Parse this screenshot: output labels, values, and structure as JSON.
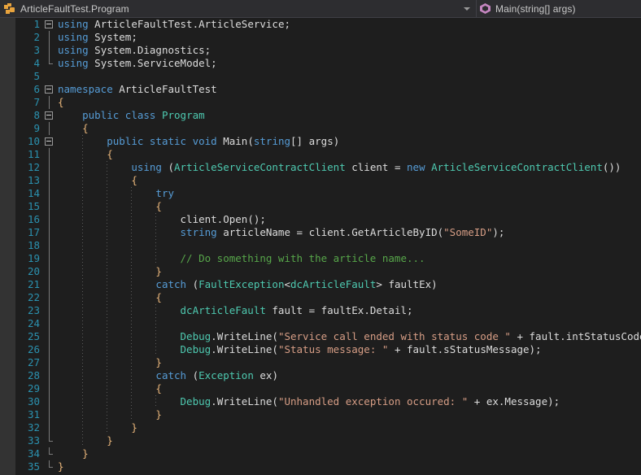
{
  "navbar": {
    "class_dropdown": {
      "icon": "class-icon",
      "label": "ArticleFaultTest.Program"
    },
    "method_dropdown": {
      "icon": "method-icon",
      "label": "Main(string[] args)"
    },
    "dropdown_arrow_icon": "chevron-down-icon"
  },
  "colors": {
    "background": "#1e1e1e",
    "navbar_background": "#2d2d30",
    "indicator_margin": "#333333",
    "line_number": "#2b91af",
    "keyword": "#569cd6",
    "type": "#4ec9b0",
    "string": "#d69d85",
    "comment": "#57a64a",
    "plain_text": "#dcdcdc",
    "brace": "#e8b57a",
    "class_icon": "#e8a33d",
    "method_icon": "#c586c0"
  },
  "editor": {
    "language": "csharp",
    "first_line": 1,
    "last_line": 35,
    "lines": [
      {
        "n": 1,
        "fold": "box",
        "indent": 0,
        "tokens": [
          {
            "t": "k",
            "v": "using"
          },
          {
            "t": "p",
            "v": " "
          },
          {
            "t": "p",
            "v": "ArticleFaultTest"
          },
          {
            "t": "op",
            "v": "."
          },
          {
            "t": "p",
            "v": "ArticleService"
          },
          {
            "t": "op",
            "v": ";"
          }
        ]
      },
      {
        "n": 2,
        "fold": "line",
        "indent": 0,
        "tokens": [
          {
            "t": "k",
            "v": "using"
          },
          {
            "t": "p",
            "v": " System"
          },
          {
            "t": "op",
            "v": ";"
          }
        ]
      },
      {
        "n": 3,
        "fold": "line",
        "indent": 0,
        "tokens": [
          {
            "t": "k",
            "v": "using"
          },
          {
            "t": "p",
            "v": " System"
          },
          {
            "t": "op",
            "v": "."
          },
          {
            "t": "p",
            "v": "Diagnostics"
          },
          {
            "t": "op",
            "v": ";"
          }
        ]
      },
      {
        "n": 4,
        "fold": "endcap",
        "indent": 0,
        "tokens": [
          {
            "t": "k",
            "v": "using"
          },
          {
            "t": "p",
            "v": " System"
          },
          {
            "t": "op",
            "v": "."
          },
          {
            "t": "p",
            "v": "ServiceModel"
          },
          {
            "t": "op",
            "v": ";"
          }
        ]
      },
      {
        "n": 5,
        "fold": "none",
        "indent": 0,
        "tokens": []
      },
      {
        "n": 6,
        "fold": "box",
        "indent": 0,
        "tokens": [
          {
            "t": "k",
            "v": "namespace"
          },
          {
            "t": "p",
            "v": " ArticleFaultTest"
          }
        ]
      },
      {
        "n": 7,
        "fold": "line",
        "indent": 0,
        "tokens": [
          {
            "t": "b",
            "v": "{"
          }
        ]
      },
      {
        "n": 8,
        "fold": "box",
        "indent": 1,
        "tokens": [
          {
            "t": "k",
            "v": "public"
          },
          {
            "t": "p",
            "v": " "
          },
          {
            "t": "k",
            "v": "class"
          },
          {
            "t": "p",
            "v": " "
          },
          {
            "t": "t",
            "v": "Program"
          }
        ]
      },
      {
        "n": 9,
        "fold": "line",
        "indent": 1,
        "tokens": [
          {
            "t": "b",
            "v": "{"
          }
        ]
      },
      {
        "n": 10,
        "fold": "box",
        "indent": 2,
        "tokens": [
          {
            "t": "k",
            "v": "public"
          },
          {
            "t": "p",
            "v": " "
          },
          {
            "t": "k",
            "v": "static"
          },
          {
            "t": "p",
            "v": " "
          },
          {
            "t": "k",
            "v": "void"
          },
          {
            "t": "p",
            "v": " Main"
          },
          {
            "t": "op",
            "v": "("
          },
          {
            "t": "k",
            "v": "string"
          },
          {
            "t": "op",
            "v": "[]"
          },
          {
            "t": "p",
            "v": " args"
          },
          {
            "t": "op",
            "v": ")"
          }
        ]
      },
      {
        "n": 11,
        "fold": "line",
        "indent": 2,
        "tokens": [
          {
            "t": "b",
            "v": "{"
          }
        ]
      },
      {
        "n": 12,
        "fold": "line",
        "indent": 3,
        "tokens": [
          {
            "t": "k",
            "v": "using"
          },
          {
            "t": "p",
            "v": " "
          },
          {
            "t": "op",
            "v": "("
          },
          {
            "t": "t",
            "v": "ArticleServiceContractClient"
          },
          {
            "t": "p",
            "v": " client "
          },
          {
            "t": "op",
            "v": "= "
          },
          {
            "t": "k",
            "v": "new"
          },
          {
            "t": "p",
            "v": " "
          },
          {
            "t": "t",
            "v": "ArticleServiceContractClient"
          },
          {
            "t": "op",
            "v": "())"
          }
        ]
      },
      {
        "n": 13,
        "fold": "line",
        "indent": 3,
        "tokens": [
          {
            "t": "b",
            "v": "{"
          }
        ]
      },
      {
        "n": 14,
        "fold": "line",
        "indent": 4,
        "tokens": [
          {
            "t": "k",
            "v": "try"
          }
        ]
      },
      {
        "n": 15,
        "fold": "line",
        "indent": 4,
        "tokens": [
          {
            "t": "b",
            "v": "{"
          }
        ]
      },
      {
        "n": 16,
        "fold": "line",
        "indent": 5,
        "tokens": [
          {
            "t": "p",
            "v": "client"
          },
          {
            "t": "op",
            "v": "."
          },
          {
            "t": "p",
            "v": "Open"
          },
          {
            "t": "op",
            "v": "();"
          }
        ]
      },
      {
        "n": 17,
        "fold": "line",
        "indent": 5,
        "tokens": [
          {
            "t": "k",
            "v": "string"
          },
          {
            "t": "p",
            "v": " articleName "
          },
          {
            "t": "op",
            "v": "= "
          },
          {
            "t": "p",
            "v": "client"
          },
          {
            "t": "op",
            "v": "."
          },
          {
            "t": "p",
            "v": "GetArticleByID"
          },
          {
            "t": "op",
            "v": "("
          },
          {
            "t": "s",
            "v": "\"SomeID\""
          },
          {
            "t": "op",
            "v": ");"
          }
        ]
      },
      {
        "n": 18,
        "fold": "line",
        "indent": 5,
        "tokens": []
      },
      {
        "n": 19,
        "fold": "line",
        "indent": 5,
        "tokens": [
          {
            "t": "c",
            "v": "// Do something with the article name..."
          }
        ]
      },
      {
        "n": 20,
        "fold": "line",
        "indent": 4,
        "tokens": [
          {
            "t": "b",
            "v": "}"
          }
        ]
      },
      {
        "n": 21,
        "fold": "line",
        "indent": 4,
        "tokens": [
          {
            "t": "k",
            "v": "catch"
          },
          {
            "t": "p",
            "v": " "
          },
          {
            "t": "op",
            "v": "("
          },
          {
            "t": "t",
            "v": "FaultException"
          },
          {
            "t": "op",
            "v": "<"
          },
          {
            "t": "t",
            "v": "dcArticleFault"
          },
          {
            "t": "op",
            "v": "> "
          },
          {
            "t": "p",
            "v": "faultEx"
          },
          {
            "t": "op",
            "v": ")"
          }
        ]
      },
      {
        "n": 22,
        "fold": "line",
        "indent": 4,
        "tokens": [
          {
            "t": "b",
            "v": "{"
          }
        ]
      },
      {
        "n": 23,
        "fold": "line",
        "indent": 5,
        "tokens": [
          {
            "t": "t",
            "v": "dcArticleFault"
          },
          {
            "t": "p",
            "v": " fault "
          },
          {
            "t": "op",
            "v": "= "
          },
          {
            "t": "p",
            "v": "faultEx"
          },
          {
            "t": "op",
            "v": "."
          },
          {
            "t": "p",
            "v": "Detail"
          },
          {
            "t": "op",
            "v": ";"
          }
        ]
      },
      {
        "n": 24,
        "fold": "line",
        "indent": 5,
        "tokens": []
      },
      {
        "n": 25,
        "fold": "line",
        "indent": 5,
        "tokens": [
          {
            "t": "t",
            "v": "Debug"
          },
          {
            "t": "op",
            "v": "."
          },
          {
            "t": "p",
            "v": "WriteLine"
          },
          {
            "t": "op",
            "v": "("
          },
          {
            "t": "s",
            "v": "\"Service call ended with status code \""
          },
          {
            "t": "op",
            "v": " + "
          },
          {
            "t": "p",
            "v": "fault"
          },
          {
            "t": "op",
            "v": "."
          },
          {
            "t": "p",
            "v": "intStatusCode"
          },
          {
            "t": "op",
            "v": ");"
          }
        ]
      },
      {
        "n": 26,
        "fold": "line",
        "indent": 5,
        "tokens": [
          {
            "t": "t",
            "v": "Debug"
          },
          {
            "t": "op",
            "v": "."
          },
          {
            "t": "p",
            "v": "WriteLine"
          },
          {
            "t": "op",
            "v": "("
          },
          {
            "t": "s",
            "v": "\"Status message: \""
          },
          {
            "t": "op",
            "v": " + "
          },
          {
            "t": "p",
            "v": "fault"
          },
          {
            "t": "op",
            "v": "."
          },
          {
            "t": "p",
            "v": "sStatusMessage"
          },
          {
            "t": "op",
            "v": ");"
          }
        ]
      },
      {
        "n": 27,
        "fold": "line",
        "indent": 4,
        "tokens": [
          {
            "t": "b",
            "v": "}"
          }
        ]
      },
      {
        "n": 28,
        "fold": "line",
        "indent": 4,
        "tokens": [
          {
            "t": "k",
            "v": "catch"
          },
          {
            "t": "p",
            "v": " "
          },
          {
            "t": "op",
            "v": "("
          },
          {
            "t": "t",
            "v": "Exception"
          },
          {
            "t": "p",
            "v": " ex"
          },
          {
            "t": "op",
            "v": ")"
          }
        ]
      },
      {
        "n": 29,
        "fold": "line",
        "indent": 4,
        "tokens": [
          {
            "t": "b",
            "v": "{"
          }
        ]
      },
      {
        "n": 30,
        "fold": "line",
        "indent": 5,
        "tokens": [
          {
            "t": "t",
            "v": "Debug"
          },
          {
            "t": "op",
            "v": "."
          },
          {
            "t": "p",
            "v": "WriteLine"
          },
          {
            "t": "op",
            "v": "("
          },
          {
            "t": "s",
            "v": "\"Unhandled exception occured: \""
          },
          {
            "t": "op",
            "v": " + "
          },
          {
            "t": "p",
            "v": "ex"
          },
          {
            "t": "op",
            "v": "."
          },
          {
            "t": "p",
            "v": "Message"
          },
          {
            "t": "op",
            "v": ");"
          }
        ]
      },
      {
        "n": 31,
        "fold": "line",
        "indent": 4,
        "tokens": [
          {
            "t": "b",
            "v": "}"
          }
        ]
      },
      {
        "n": 32,
        "fold": "line",
        "indent": 3,
        "tokens": [
          {
            "t": "b",
            "v": "}"
          }
        ]
      },
      {
        "n": 33,
        "fold": "endcap",
        "indent": 2,
        "tokens": [
          {
            "t": "b",
            "v": "}"
          }
        ]
      },
      {
        "n": 34,
        "fold": "endcap",
        "indent": 1,
        "tokens": [
          {
            "t": "b",
            "v": "}"
          }
        ]
      },
      {
        "n": 35,
        "fold": "endcap",
        "indent": 0,
        "tokens": [
          {
            "t": "b",
            "v": "}"
          }
        ]
      }
    ]
  }
}
